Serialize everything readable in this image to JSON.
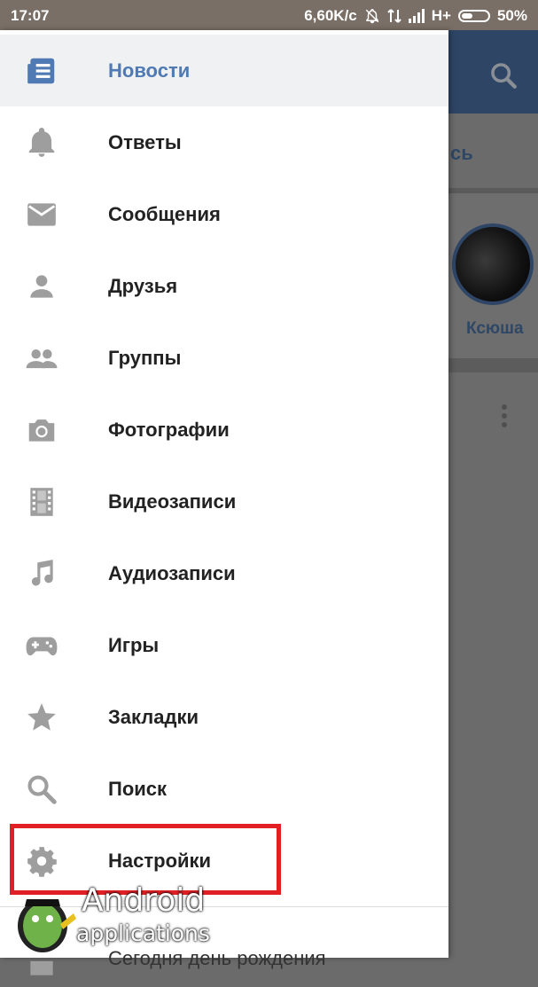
{
  "status_bar": {
    "time": "17:07",
    "speed": "6,60K/c",
    "network": "H+",
    "battery": "50%"
  },
  "background": {
    "tab_fragment": "сь",
    "story_name": "Ксюша"
  },
  "menu": {
    "items": [
      {
        "label": "Новости",
        "icon": "news-icon",
        "active": true
      },
      {
        "label": "Ответы",
        "icon": "bell-icon"
      },
      {
        "label": "Сообщения",
        "icon": "mail-icon"
      },
      {
        "label": "Друзья",
        "icon": "person-icon"
      },
      {
        "label": "Группы",
        "icon": "group-icon"
      },
      {
        "label": "Фотографии",
        "icon": "camera-icon"
      },
      {
        "label": "Видеозаписи",
        "icon": "film-icon"
      },
      {
        "label": "Аудиозаписи",
        "icon": "music-note-icon"
      },
      {
        "label": "Игры",
        "icon": "gamepad-icon"
      },
      {
        "label": "Закладки",
        "icon": "star-icon"
      },
      {
        "label": "Поиск",
        "icon": "search-icon"
      },
      {
        "label": "Настройки",
        "icon": "gear-icon"
      }
    ],
    "birthday_text": "Сегодня день рождения"
  },
  "watermark": {
    "line1": "Android",
    "line2": "applications"
  },
  "colors": {
    "accent": "#4f7ab3",
    "header": "#2e4566",
    "highlight": "#e02024",
    "icon_gray": "#9e9e9e"
  }
}
